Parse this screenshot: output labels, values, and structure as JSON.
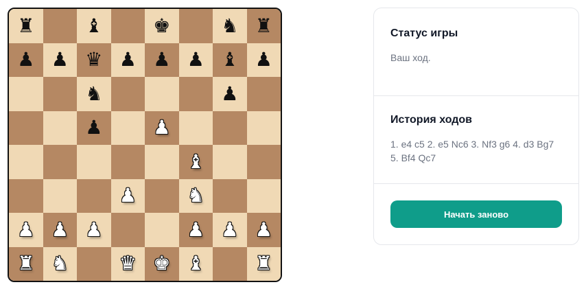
{
  "board": {
    "light_color": "#f0d9b5",
    "dark_color": "#b58863",
    "ranks": [
      [
        "r",
        "",
        "b",
        "",
        "k",
        "",
        "n",
        "r"
      ],
      [
        "p",
        "p",
        "q",
        "p",
        "p",
        "p",
        "b",
        "p"
      ],
      [
        "",
        "",
        "n",
        "",
        "",
        "",
        "p",
        ""
      ],
      [
        "",
        "",
        "p",
        "",
        "P",
        "",
        "",
        ""
      ],
      [
        "",
        "",
        "",
        "",
        "",
        "B",
        "",
        ""
      ],
      [
        "",
        "",
        "",
        "P",
        "",
        "N",
        "",
        ""
      ],
      [
        "P",
        "P",
        "P",
        "",
        "",
        "P",
        "P",
        "P"
      ],
      [
        "R",
        "N",
        "",
        "Q",
        "K",
        "B",
        "",
        "R"
      ]
    ]
  },
  "status": {
    "title": "Статус игры",
    "text": "Ваш ход."
  },
  "history": {
    "title": "История ходов",
    "moves": "1. e4 c5 2. e5 Nc6 3. Nf3 g6 4. d3 Bg7 5. Bf4 Qc7"
  },
  "actions": {
    "restart_label": "Начать заново",
    "restart_color": "#0f9d8a"
  }
}
